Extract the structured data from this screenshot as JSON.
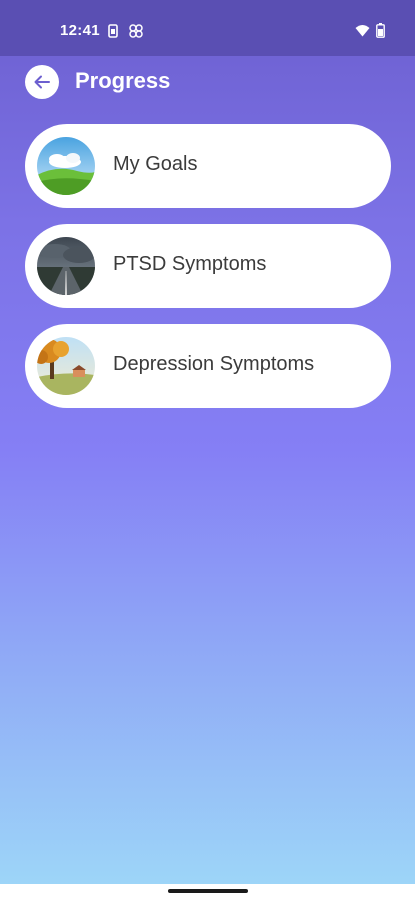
{
  "status_bar": {
    "time": "12:41",
    "icons": [
      "sim-card-icon",
      "pinwheel-icon",
      "wifi-icon",
      "battery-icon"
    ]
  },
  "header": {
    "title": "Progress",
    "back_icon": "arrow-left-icon"
  },
  "items": [
    {
      "label": "My Goals",
      "image": "green-hills-sky-image"
    },
    {
      "label": "PTSD Symptoms",
      "image": "stormy-road-image"
    },
    {
      "label": "Depression Symptoms",
      "image": "autumn-tree-landscape-image"
    }
  ],
  "colors": {
    "status_bar": "#5a4fb3",
    "gradient_top": "#6c5fcf",
    "gradient_bottom": "#9ed8f8",
    "card": "#ffffff",
    "back_arrow": "#6c5fcf"
  }
}
